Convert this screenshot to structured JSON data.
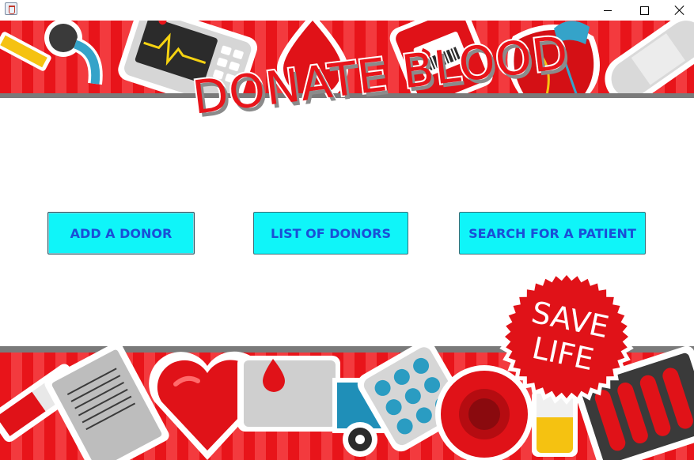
{
  "window": {
    "title": "",
    "controls": {
      "minimize": "minimize",
      "maximize": "maximize",
      "close": "close"
    }
  },
  "header": {
    "logo_text": "DONATE BLOOD"
  },
  "actions": [
    {
      "label": "ADD A DONOR"
    },
    {
      "label": "LIST OF DONORS"
    },
    {
      "label": "SEARCH FOR A PATIENT"
    }
  ],
  "badge": {
    "line1": "SAVE",
    "line2": "LIFE"
  },
  "colors": {
    "brand_red": "#e8141a",
    "button_fill": "#0ff5f9",
    "button_text": "#1a4fd6",
    "background": "#ffffff"
  },
  "icons": [
    "java-app-icon",
    "minimize-icon",
    "maximize-icon",
    "close-icon"
  ]
}
